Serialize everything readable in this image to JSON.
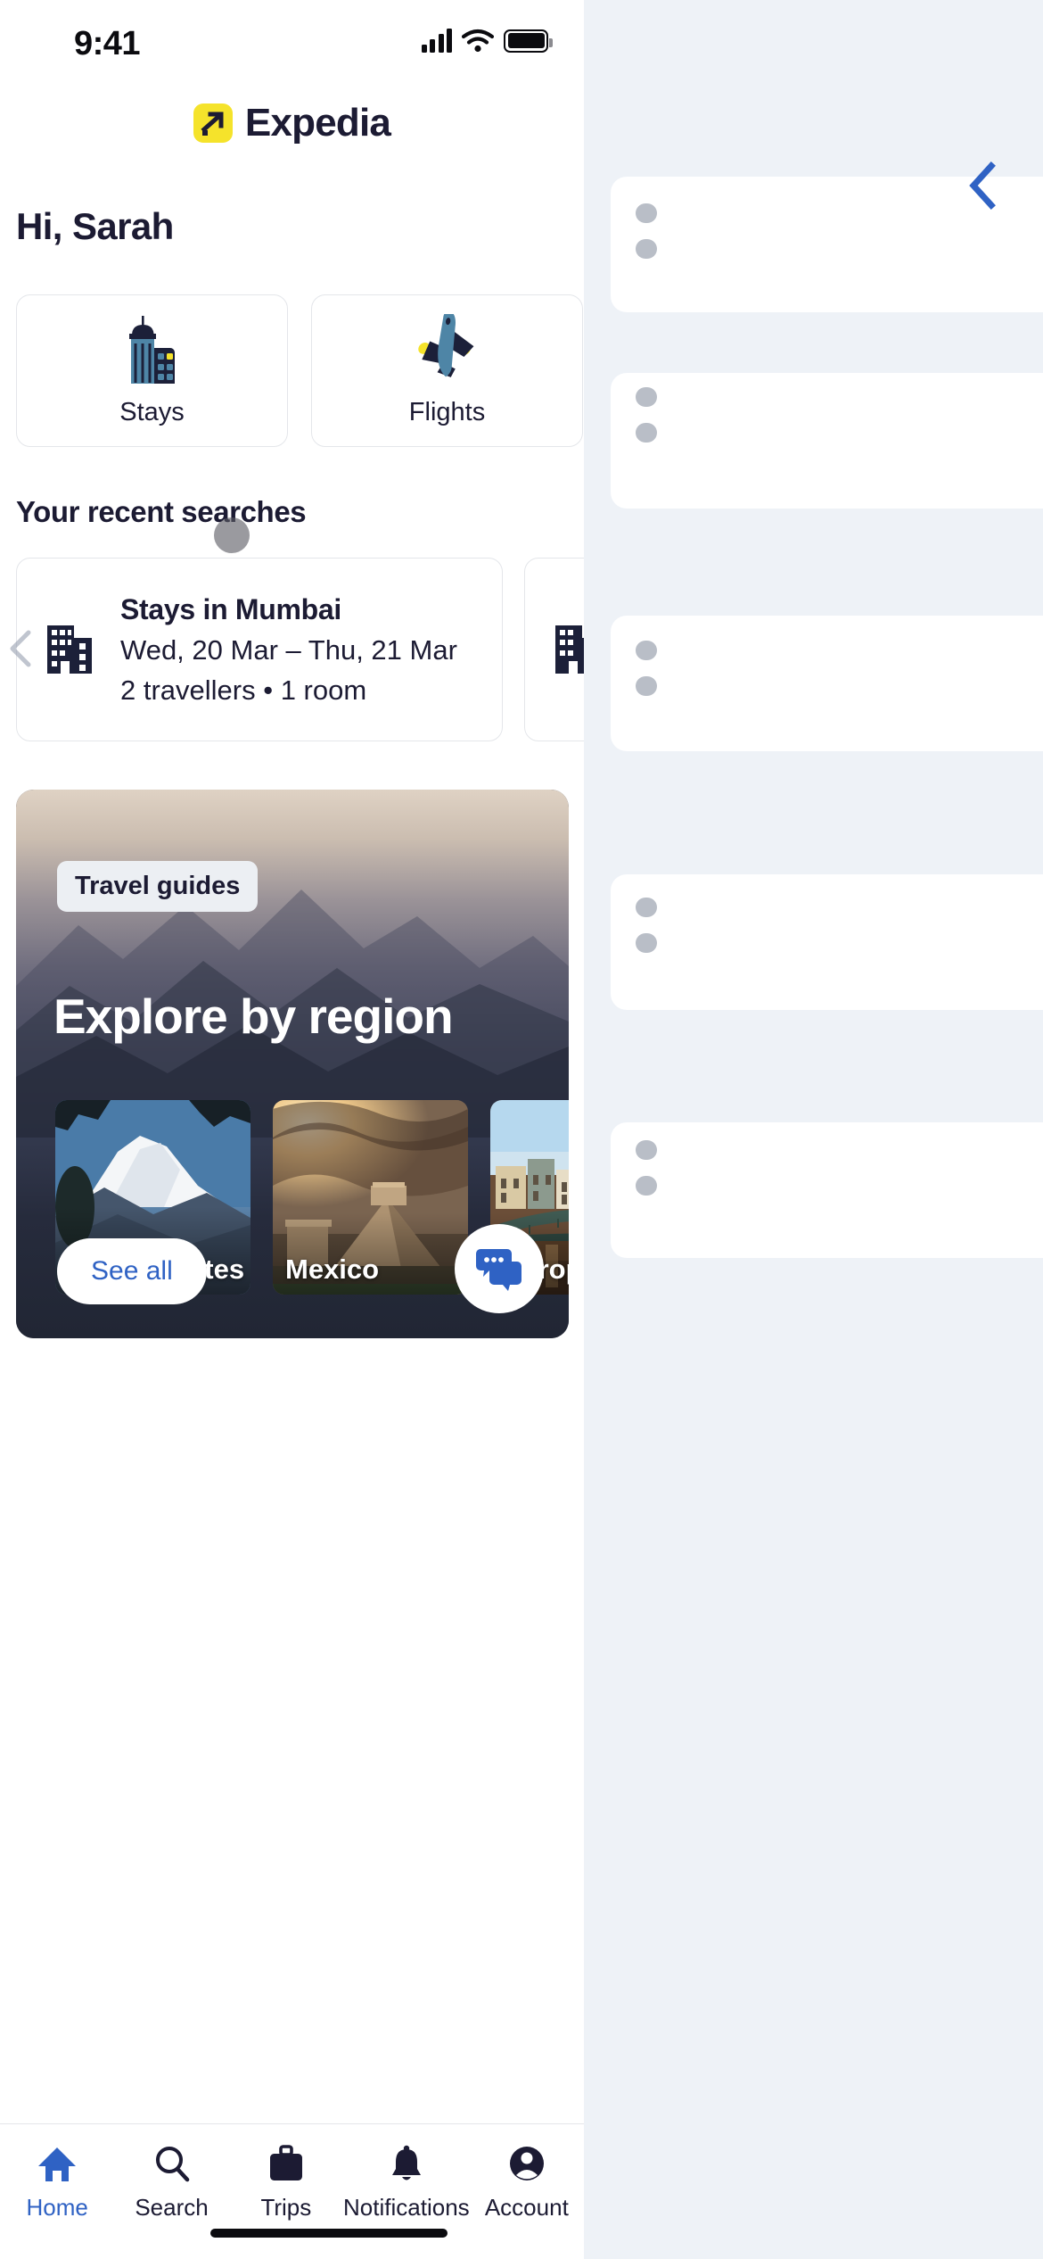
{
  "status_bar": {
    "time": "9:41",
    "cellular_icon": "signal-bars-icon",
    "wifi_icon": "wifi-icon",
    "battery_icon": "battery-full-icon"
  },
  "header": {
    "brand_name": "Expedia",
    "brand_mark_icon": "expedia-arrow-logo-icon",
    "brand_mark_color": "#F5E32B",
    "back_chevron_icon": "chevron-left-icon",
    "back_chevron_color": "#2F62C4"
  },
  "greeting": "Hi, Sarah",
  "quick_actions": [
    {
      "label": "Stays",
      "icon": "building-hotel-icon"
    },
    {
      "label": "Flights",
      "icon": "airplane-icon"
    }
  ],
  "recent_searches": {
    "section_title": "Your recent searches",
    "prev_arrow_icon": "chevron-left-icon",
    "items": [
      {
        "icon": "office-building-icon",
        "title": "Stays in Mumbai",
        "dates": "Wed, 20 Mar – Thu, 21 Mar",
        "meta": "2 travellers • 1 room"
      },
      {
        "icon": "office-building-icon",
        "title": "",
        "dates": "",
        "meta": ""
      }
    ]
  },
  "travel_guides": {
    "badge": "Travel guides",
    "heading": "Explore by region",
    "see_all_label": "See all",
    "see_all_color": "#2F62C4",
    "chat_icon": "chat-bubbles-icon",
    "chat_icon_color": "#2F62C4",
    "regions": [
      {
        "label": "United States"
      },
      {
        "label": "Mexico"
      },
      {
        "label": "Europe"
      }
    ]
  },
  "tab_bar": {
    "active_color": "#2F62C4",
    "inactive_color": "#1C1B33",
    "tabs": [
      {
        "label": "Home",
        "icon": "home-icon",
        "active": true
      },
      {
        "label": "Search",
        "icon": "search-icon",
        "active": false
      },
      {
        "label": "Trips",
        "icon": "briefcase-icon",
        "active": false
      },
      {
        "label": "Notifications",
        "icon": "bell-icon",
        "active": false
      },
      {
        "label": "Account",
        "icon": "account-circle-icon",
        "active": false
      }
    ]
  }
}
